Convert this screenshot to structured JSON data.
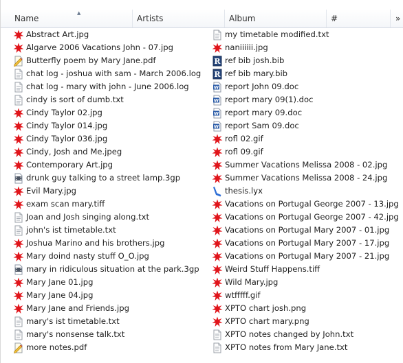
{
  "columns": {
    "name": "Name",
    "artists": "Artists",
    "album": "Album",
    "number": "#",
    "more": "»"
  },
  "left_column": [
    {
      "name": "Abstract Art.jpg",
      "type": "jpg"
    },
    {
      "name": "Algarve 2006 Vacations John - 07.jpg",
      "type": "jpg"
    },
    {
      "name": "Butterfly poem by Mary Jane.pdf",
      "type": "pdf"
    },
    {
      "name": "chat log - joshua with sam - March 2006.log",
      "type": "txt"
    },
    {
      "name": "chat log - mary with john - June 2006.log",
      "type": "txt"
    },
    {
      "name": "cindy is sort of dumb.txt",
      "type": "txt"
    },
    {
      "name": "Cindy Taylor 02.jpg",
      "type": "jpg"
    },
    {
      "name": "Cindy Taylor 014.jpg",
      "type": "jpg"
    },
    {
      "name": "Cindy Taylor 036.jpg",
      "type": "jpg"
    },
    {
      "name": "Cindy, Josh and Me.jpeg",
      "type": "jpg"
    },
    {
      "name": "Contemporary Art.jpg",
      "type": "jpg"
    },
    {
      "name": "drunk guy talking to a street lamp.3gp",
      "type": "video"
    },
    {
      "name": "Evil Mary.jpg",
      "type": "jpg"
    },
    {
      "name": "exam scan mary.tiff",
      "type": "jpg"
    },
    {
      "name": "Joan and Josh singing along.txt",
      "type": "txt"
    },
    {
      "name": "john's ist timetable.txt",
      "type": "txt"
    },
    {
      "name": "Joshua Marino and his brothers.jpg",
      "type": "jpg"
    },
    {
      "name": "Mary doind nasty stuff O_O.jpg",
      "type": "jpg"
    },
    {
      "name": "mary in ridiculous situation at the park.3gp",
      "type": "video"
    },
    {
      "name": "Mary Jane 01.jpg",
      "type": "jpg"
    },
    {
      "name": "Mary Jane 04.jpg",
      "type": "jpg"
    },
    {
      "name": "Mary Jane and Friends.jpg",
      "type": "jpg"
    },
    {
      "name": "mary's ist timetable.txt",
      "type": "txt"
    },
    {
      "name": "mary's nonsense talk.txt",
      "type": "txt"
    },
    {
      "name": "more notes.pdf",
      "type": "pdf"
    }
  ],
  "right_column": [
    {
      "name": "my timetable modified.txt",
      "type": "txt"
    },
    {
      "name": "naniiiiii.jpg",
      "type": "jpg"
    },
    {
      "name": "ref bib josh.bib",
      "type": "bib"
    },
    {
      "name": "ref bib mary.bib",
      "type": "bib"
    },
    {
      "name": "report John 09.doc",
      "type": "doc"
    },
    {
      "name": "report mary 09(1).doc",
      "type": "doc"
    },
    {
      "name": "report mary 09.doc",
      "type": "doc"
    },
    {
      "name": "report Sam 09.doc",
      "type": "doc"
    },
    {
      "name": "rofl 02.gif",
      "type": "jpg"
    },
    {
      "name": "rofl 09.gif",
      "type": "jpg"
    },
    {
      "name": "Summer Vacations Melissa 2008 - 02.jpg",
      "type": "jpg"
    },
    {
      "name": "Summer Vacations Melissa 2008 - 24.jpg",
      "type": "jpg"
    },
    {
      "name": "thesis.lyx",
      "type": "lyx"
    },
    {
      "name": "Vacations on Portugal George 2007 - 13.jpg",
      "type": "jpg"
    },
    {
      "name": "Vacations on Portugal George 2007 - 42.jpg",
      "type": "jpg"
    },
    {
      "name": "Vacations on Portugal Mary 2007 - 01.jpg",
      "type": "jpg"
    },
    {
      "name": "Vacations on Portugal Mary 2007 - 17.jpg",
      "type": "jpg"
    },
    {
      "name": "Vacations on Portugal Mary 2007 - 21.jpg",
      "type": "jpg"
    },
    {
      "name": "Weird Stuff Happens.tiff",
      "type": "jpg"
    },
    {
      "name": "Wild Mary.jpg",
      "type": "jpg"
    },
    {
      "name": "wtfffff.gif",
      "type": "jpg"
    },
    {
      "name": "XPTO chart josh.png",
      "type": "jpg"
    },
    {
      "name": "XPTO chart mary.png",
      "type": "jpg"
    },
    {
      "name": "XPTO notes changed by John.txt",
      "type": "txt"
    },
    {
      "name": "XPTO notes from Mary Jane.txt",
      "type": "txt"
    }
  ],
  "icons": {
    "jpg": "image-file-icon",
    "txt": "text-file-icon",
    "pdf": "pdf-file-icon",
    "doc": "word-document-icon",
    "bib": "bibtex-file-icon",
    "video": "video-file-icon",
    "lyx": "lyx-file-icon"
  },
  "colors": {
    "image_icon": "#e0141a",
    "doc_icon": "#2b5ca8",
    "lyx_icon": "#2f6fd6",
    "header_border": "#d5dbe5"
  }
}
